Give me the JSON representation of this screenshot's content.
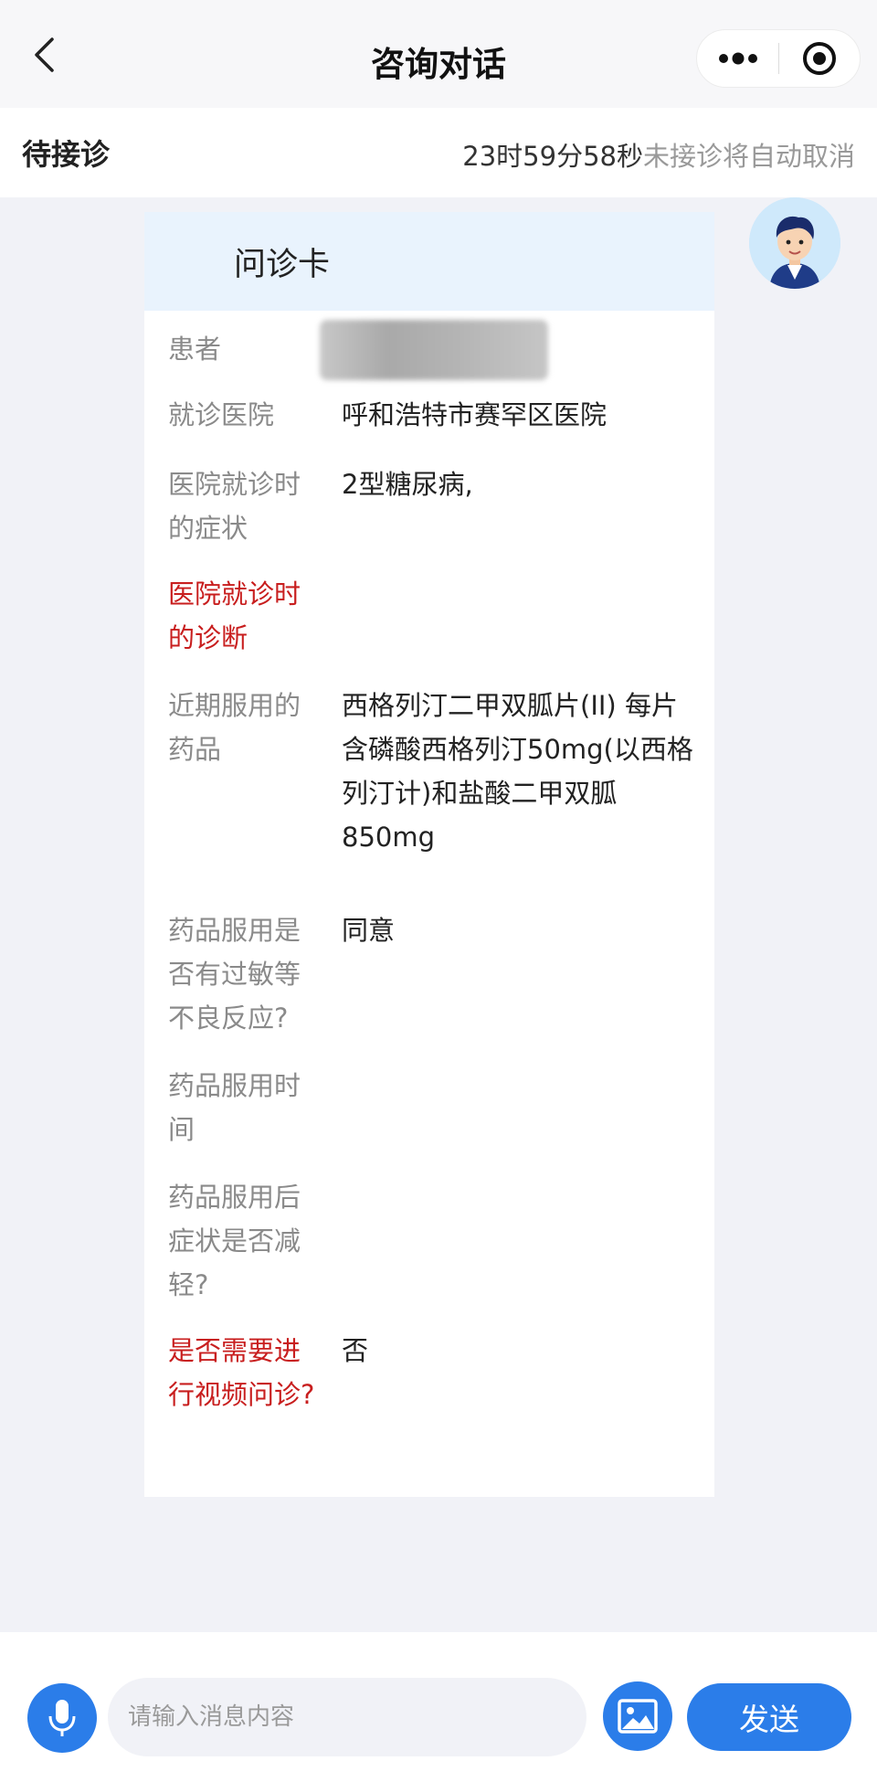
{
  "header": {
    "title": "咨询对话",
    "back_icon": "chevron-left-icon",
    "more_icon": "more-dots-icon",
    "close_icon": "target-circle-icon"
  },
  "status": {
    "label": "待接诊",
    "countdown": "23时59分58秒",
    "countdown_suffix": "未接诊将自动取消"
  },
  "card": {
    "title": "问诊卡",
    "rows": [
      {
        "label": "患者",
        "value": ""
      },
      {
        "label": "就诊医院",
        "value": "呼和浩特市赛罕区医院"
      },
      {
        "label": "医院就诊时的症状",
        "value": "2型糖尿病,"
      },
      {
        "label": "医院就诊时的诊断",
        "value": ""
      },
      {
        "label": "近期服用的药品",
        "value": "西格列汀二甲双胍片(II) 每片含磷酸西格列汀50mg(以西格列汀计)和盐酸二甲双胍850mg"
      },
      {
        "label": "药品服用是否有过敏等不良反应?",
        "value": "同意"
      },
      {
        "label": "药品服用时间",
        "value": ""
      },
      {
        "label": "药品服用后症状是否减轻?",
        "value": ""
      },
      {
        "label": "是否需要进行视频问诊?",
        "value": "否"
      }
    ]
  },
  "input": {
    "placeholder": "请输入消息内容",
    "send_label": "发送",
    "voice_icon": "microphone-icon",
    "image_icon": "image-icon"
  },
  "colors": {
    "accent": "#2b7de9",
    "required_label": "#c81e1e",
    "card_header_bg": "#e9f3fd"
  }
}
